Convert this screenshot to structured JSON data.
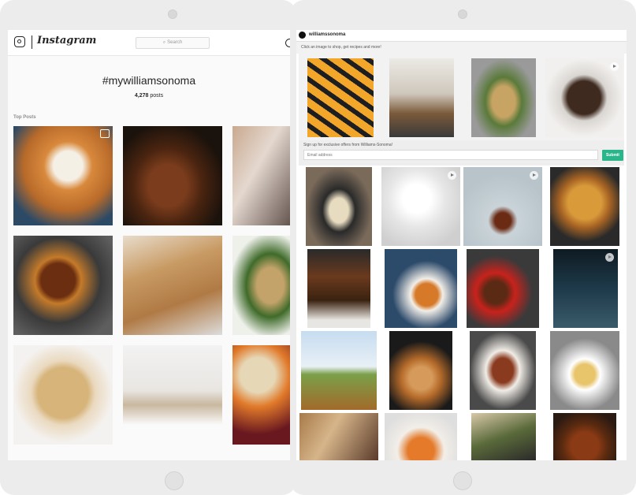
{
  "instagram": {
    "wordmark": "Instagram",
    "search_placeholder": "Search",
    "hashtag": "#mywilliamsonoma",
    "post_count": "4,278",
    "post_count_suffix": "posts",
    "top_posts_label": "Top Posts"
  },
  "williams_sonoma": {
    "account_name": "williamssonoma",
    "cta_text": "Click an image to shop, get recipes and more!",
    "signup_text": "Sign up for exclusive offers from Williams-Sonoma!",
    "email_placeholder": "Email address",
    "submit_label": "Submit",
    "submit_color": "#2bb58b"
  },
  "icons": [
    "instagram-camera-icon",
    "search-icon",
    "compass-icon",
    "multiple-photos-icon",
    "play-icon"
  ]
}
